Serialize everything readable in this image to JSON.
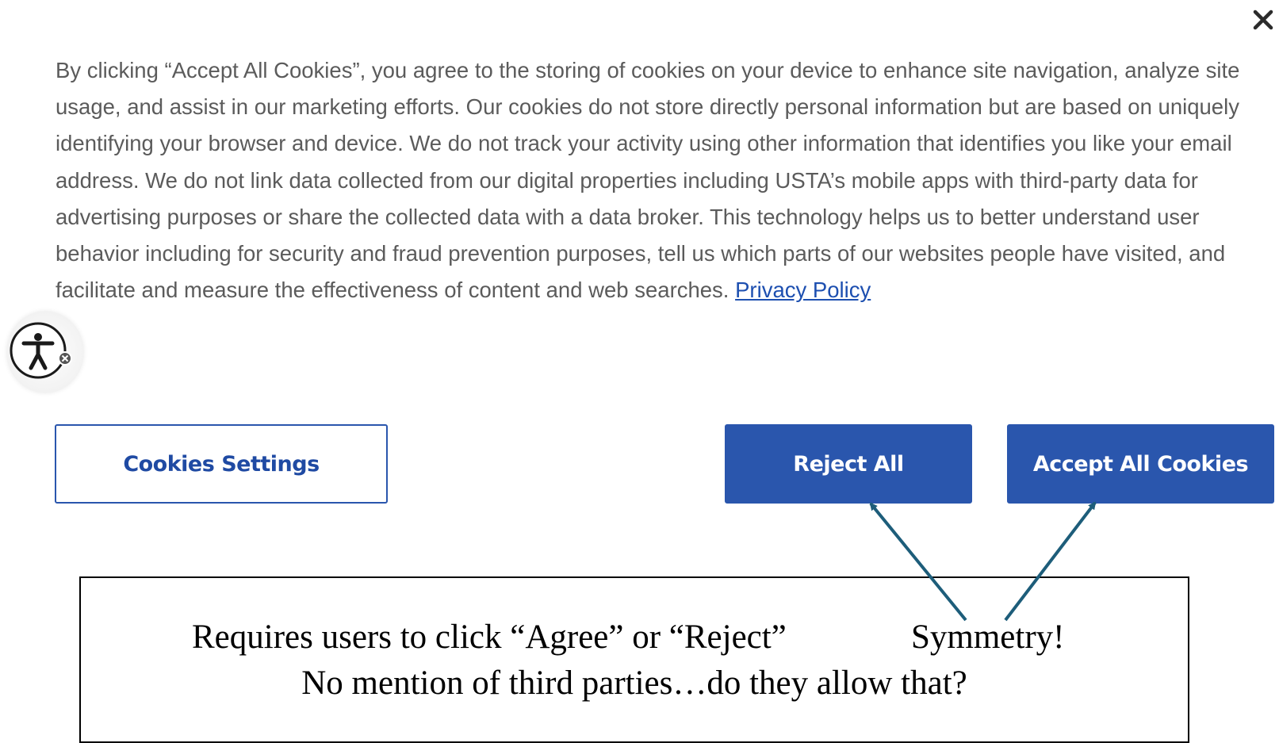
{
  "dialog": {
    "close_icon": "close-icon",
    "body_text": "By clicking “Accept All Cookies”, you agree to the storing of cookies on your device to enhance site navigation, analyze site usage, and assist in our marketing efforts. Our cookies do not store directly personal information but are based on uniquely identifying your browser and device. We do not track your activity using other information that identifies you like your email address. We do not link data collected from our digital properties including USTA’s mobile apps with third-party data for advertising purposes or share the collected data with a data broker. This technology helps us to better understand user behavior including for security and fraud prevention purposes, tell us which parts of our websites people have visited, and facilitate and measure the effectiveness of content and web searches.",
    "privacy_link_label": "Privacy Policy",
    "buttons": {
      "settings_label": "Cookies Settings",
      "reject_label": "Reject All",
      "accept_label": "Accept All Cookies"
    }
  },
  "accessibility_widget": {
    "icon": "accessibility-icon",
    "badge_icon": "close-badge-icon"
  },
  "annotation": {
    "line1_text": "Requires users to click “Agree” or “Reject”",
    "line1_highlight": "Symmetry!",
    "line2_text": "No mention of third parties…do they allow that?"
  },
  "colors": {
    "brand_blue": "#2a56ad",
    "body_text": "#5b5b5b",
    "arrow": "#1d5d7a",
    "link": "#1d4fb0"
  }
}
